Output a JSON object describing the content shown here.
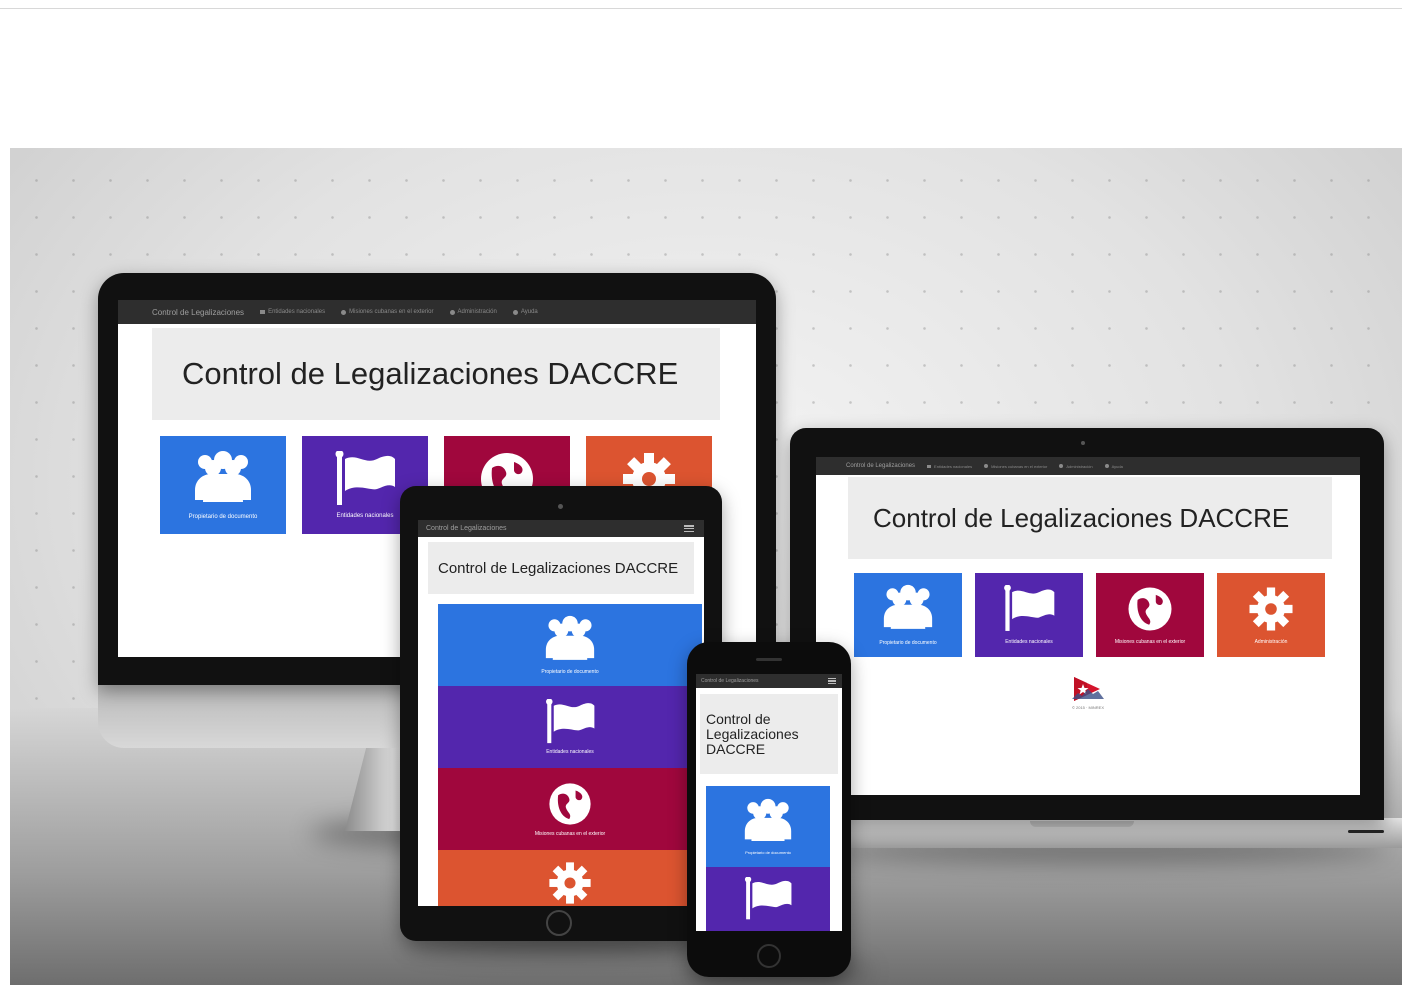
{
  "app": {
    "brand": "Control de Legalizaciones",
    "title": "Control de Legalizaciones DACCRE",
    "nav": [
      "Entidades nacionales",
      "Misiones cubanas en el exterior",
      "Administración",
      "Ayuda"
    ],
    "tiles": [
      {
        "label": "Propietario de documento",
        "icon": "users-icon",
        "color": "#2c74e0"
      },
      {
        "label": "Entidades nacionales",
        "icon": "flag-icon",
        "color": "#5326ad"
      },
      {
        "label": "Misiones cubanas en el exterior",
        "icon": "globe-icon",
        "color": "#a0073d"
      },
      {
        "label": "Administración",
        "icon": "gear-icon",
        "color": "#dc5430"
      }
    ],
    "footer": "© 2015 · MINREX"
  }
}
